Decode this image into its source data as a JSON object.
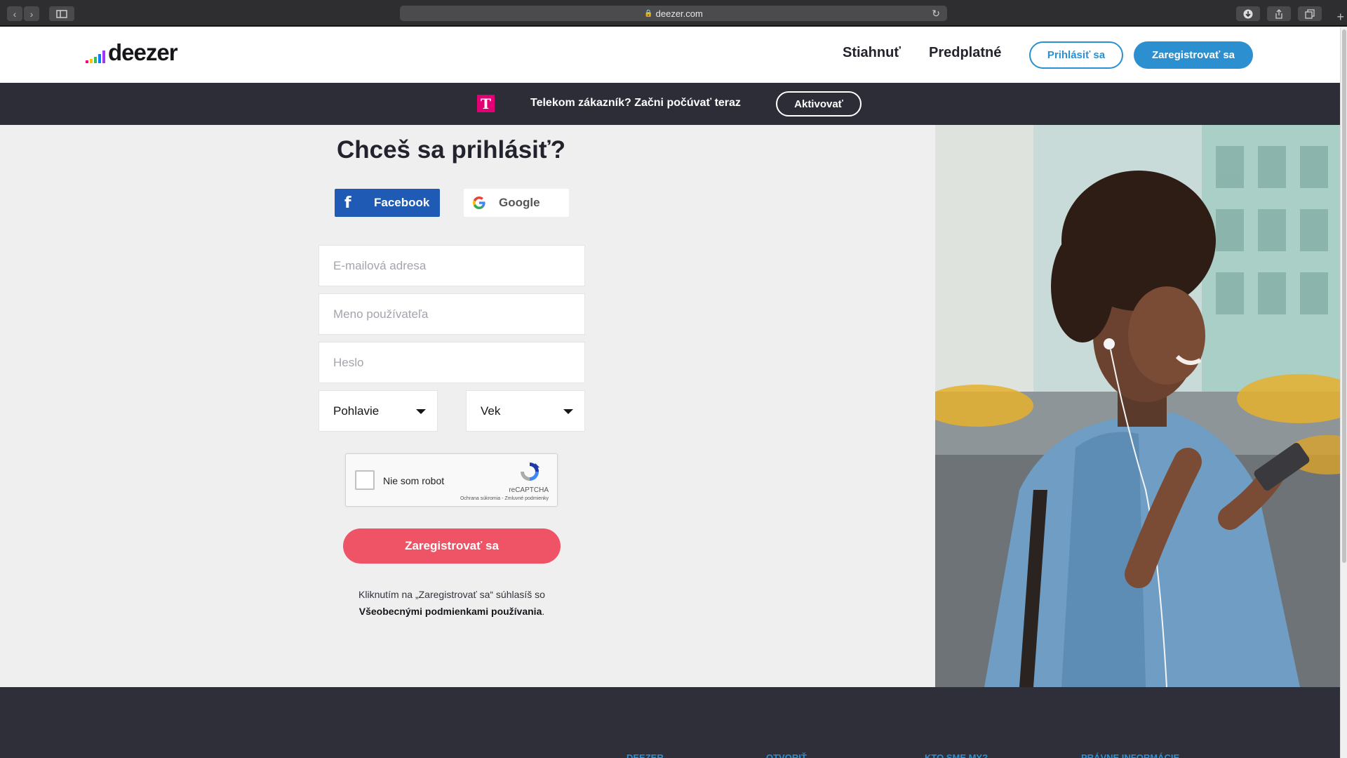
{
  "browser": {
    "url": "deezer.com",
    "lock_glyph": "🔒",
    "reload_glyph": "↻",
    "back_glyph": "‹",
    "forward_glyph": "›",
    "new_tab_glyph": "+"
  },
  "header": {
    "logo_text": "deezer",
    "nav": [
      "Stiahnuť",
      "Predplatné"
    ],
    "login_label": "Prihlásiť sa",
    "register_label": "Zaregistrovať sa"
  },
  "banner": {
    "logo_letter": "T",
    "text": "Telekom zákazník? Začni počúvať teraz",
    "button": "Aktivovať"
  },
  "form": {
    "title": "Chceš sa prihlásiť?",
    "facebook_label": "Facebook",
    "facebook_glyph": "f",
    "google_label": "Google",
    "email_placeholder": "E-mailová adresa",
    "username_placeholder": "Meno používateľa",
    "password_placeholder": "Heslo",
    "gender_label": "Pohlavie",
    "age_label": "Vek",
    "captcha_label": "Nie som robot",
    "captcha_brand": "reCAPTCHA",
    "captcha_terms": "Ochrana súkromia - Zmluvné podmienky",
    "submit_label": "Zaregistrovať sa",
    "terms_text": "Kliknutím na „Zaregistrovať sa“ súhlasíš so",
    "terms_link": "Všeobecnými podmienkami používania",
    "terms_end": "."
  },
  "footer": {
    "headings": [
      "DEEZER",
      "OTVORIŤ",
      "KTO SME MY?",
      "PRÁVNE INFORMÁCIE"
    ]
  },
  "colors": {
    "accent_blue": "#2b8fd0",
    "register_red": "#ef5466",
    "telekom_magenta": "#e20074",
    "facebook_blue": "#1f5bb5",
    "banner_bg": "#2d2d37"
  }
}
